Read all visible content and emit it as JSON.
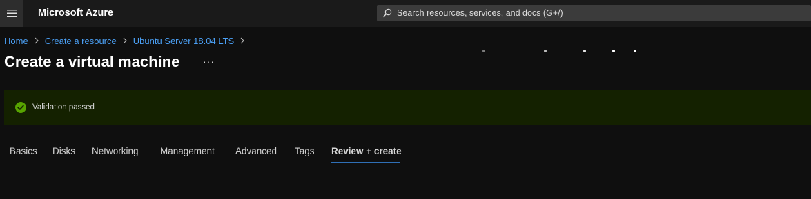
{
  "topbar": {
    "menu_icon": "hamburger-icon",
    "brand": "Microsoft Azure",
    "search": {
      "icon": "search-icon",
      "placeholder": "Search resources, services, and docs (G+/)"
    }
  },
  "breadcrumb": [
    {
      "label": "Home"
    },
    {
      "label": "Create a resource"
    },
    {
      "label": "Ubuntu Server 18.04 LTS"
    }
  ],
  "page": {
    "title": "Create a virtual machine",
    "more_label": "···"
  },
  "banner": {
    "icon": "check-circle-icon",
    "message": "Validation passed",
    "status_color": "#57a300"
  },
  "tabs": [
    {
      "label": "Basics",
      "active": false
    },
    {
      "label": "Disks",
      "active": false
    },
    {
      "label": "Networking",
      "active": false
    },
    {
      "label": "Management",
      "active": false
    },
    {
      "label": "Advanced",
      "active": false
    },
    {
      "label": "Tags",
      "active": false
    },
    {
      "label": "Review + create",
      "active": true
    }
  ],
  "colors": {
    "accent": "#4ba0f5",
    "tab_underline": "#2f6fb6",
    "banner_bg": "#142100"
  }
}
